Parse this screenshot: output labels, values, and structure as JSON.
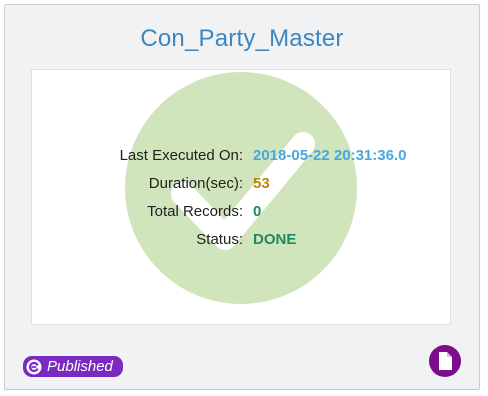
{
  "card": {
    "title": "Con_Party_Master"
  },
  "details": {
    "last_executed_label": "Last Executed On:",
    "last_executed_value": "2018-05-22 20:31:36.0",
    "duration_label": "Duration(sec):",
    "duration_value": "53",
    "total_records_label": "Total Records:",
    "total_records_value": "0",
    "status_label": "Status:",
    "status_value": "DONE"
  },
  "footer": {
    "badge_label": "Published",
    "badge_icon": "c-circle-icon",
    "document_icon": "document-icon"
  },
  "colors": {
    "title": "#3e86be",
    "watermark": "#b5d39a",
    "date_value": "#4aa7dc",
    "duration_value": "#b8860b",
    "status_value": "#1f8a5a",
    "badge_bg": "#7a2ac0"
  }
}
